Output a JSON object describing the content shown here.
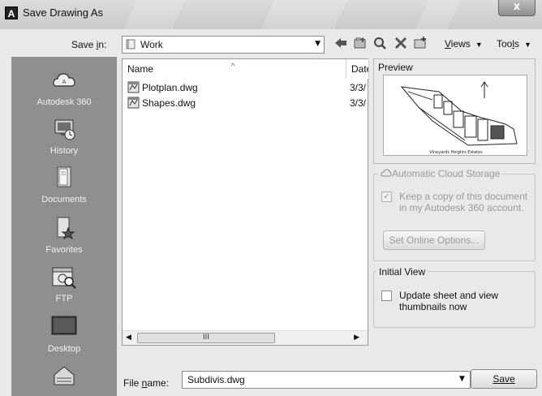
{
  "window": {
    "title": "Save Drawing As",
    "close_label": "x",
    "app_icon_letter": "A"
  },
  "toolbar": {
    "save_in_label": "Save in:",
    "save_in_value": "Work",
    "views_label": "Views",
    "tools_label": "Tools"
  },
  "places": [
    {
      "label": "Autodesk 360",
      "icon": "cloud-icon"
    },
    {
      "label": "History",
      "icon": "history-icon"
    },
    {
      "label": "Documents",
      "icon": "documents-icon"
    },
    {
      "label": "Favorites",
      "icon": "favorites-icon"
    },
    {
      "label": "FTP",
      "icon": "ftp-icon"
    },
    {
      "label": "Desktop",
      "icon": "desktop-icon"
    }
  ],
  "filelist": {
    "columns": [
      "Name",
      "Date"
    ],
    "files": [
      {
        "name": "Plotplan.dwg",
        "date": "3/3/"
      },
      {
        "name": "Shapes.dwg",
        "date": "3/3/"
      }
    ],
    "scroll_thumb_text": "III"
  },
  "preview": {
    "label": "Preview",
    "caption": "Vineyards Heights Estates"
  },
  "cloud": {
    "title": "Automatic Cloud Storage",
    "keep_copy_label": "Keep a copy of this document in my Autodesk 360 account.",
    "keep_copy_line1": "Keep a copy of this document",
    "keep_copy_line2": "in my Autodesk 360 account.",
    "set_online_options": "Set Online Options..."
  },
  "initial_view": {
    "title": "Initial View",
    "update_thumbnails_line1": "Update sheet and view",
    "update_thumbnails_line2": "thumbnails now"
  },
  "footer": {
    "file_name_label": "File name:",
    "file_name_value": "Subdivis.dwg",
    "save_button": "Save"
  }
}
